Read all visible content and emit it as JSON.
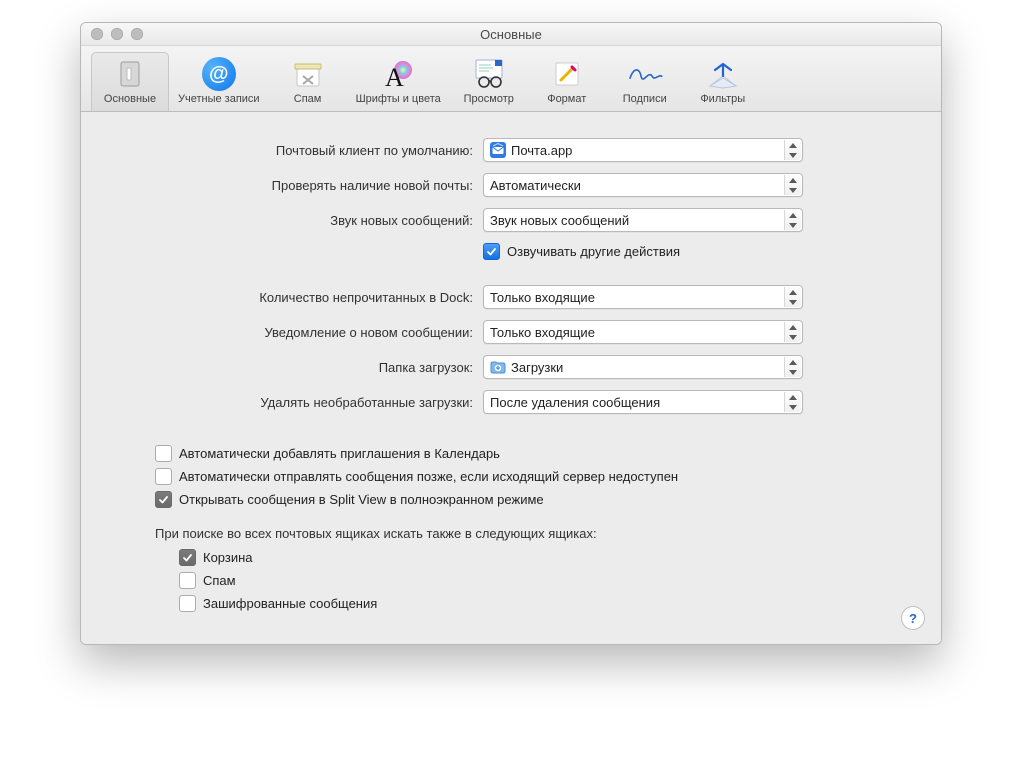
{
  "window": {
    "title": "Основные"
  },
  "toolbar": {
    "items": [
      {
        "label": "Основные"
      },
      {
        "label": "Учетные записи"
      },
      {
        "label": "Спам"
      },
      {
        "label": "Шрифты и цвета"
      },
      {
        "label": "Просмотр"
      },
      {
        "label": "Формат"
      },
      {
        "label": "Подписи"
      },
      {
        "label": "Фильтры"
      }
    ]
  },
  "labels": {
    "default_client": "Почтовый клиент по умолчанию:",
    "check_mail": "Проверять наличие новой почты:",
    "new_sound": "Звук новых сообщений:",
    "play_other": "Озвучивать другие действия",
    "dock_count": "Количество непрочитанных в Dock:",
    "new_notify": "Уведомление о новом сообщении:",
    "downloads": "Папка загрузок:",
    "remove_dl": "Удалять необработанные загрузки:",
    "auto_invite": "Автоматически добавлять приглашения в Календарь",
    "auto_later": "Автоматически отправлять сообщения позже, если исходящий сервер недоступен",
    "split_view": "Открывать сообщения в Split View в полноэкранном режиме",
    "search_header": "При поиске во всех почтовых ящиках искать также в следующих ящиках:",
    "trash": "Корзина",
    "spam": "Спам",
    "encrypted": "Зашифрованные сообщения"
  },
  "values": {
    "default_client": "Почта.app",
    "check_mail": "Автоматически",
    "new_sound": "Звук новых сообщений",
    "dock_count": "Только входящие",
    "new_notify": "Только входящие",
    "downloads": "Загрузки",
    "remove_dl": "После удаления сообщения"
  },
  "state": {
    "play_other": true,
    "auto_invite": false,
    "auto_later": false,
    "split_view": true,
    "trash": true,
    "spam": false,
    "encrypted": false
  },
  "help": "?"
}
